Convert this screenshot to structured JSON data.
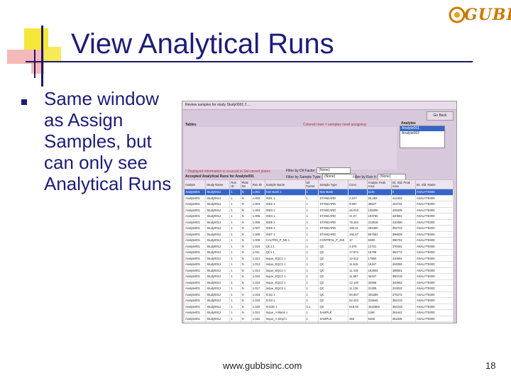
{
  "slide": {
    "title": "View Analytical Runs",
    "logo_text": "GUBBS",
    "bullet_text": "Same window as Assign Samples, but can only see Analytical Runs",
    "footer_url": "www.gubbsinc.com",
    "page_number": "18"
  },
  "screenshot": {
    "window_title": "Review samples for study Study0001 2 ...",
    "go_back_label": "Go Back",
    "tables_label": "Tables",
    "columns_note": "Colored rows = samples need assigning",
    "analytes_label": "Analytes",
    "analytes": [
      {
        "name": "Analyte001",
        "selected": true
      },
      {
        "name": "Analyte002",
        "selected": false
      }
    ],
    "filters": [
      {
        "label": "Filter by Dil Factor:",
        "value": "(None)"
      },
      {
        "label": "Filter by Sample Type:",
        "value": "(None)"
      },
      {
        "label": "Filter by Run #:",
        "value": "(None)"
      }
    ],
    "red_note": "* Displayed information is sourced in Sel-ctered plates",
    "accepted_label": "Accepted Analytical Runs for Analyte001",
    "grid": {
      "columns": [
        "Analyte",
        "Study Name",
        "Run ID",
        "Plate No",
        "Run ID",
        "Sample Name",
        "Dil Factor",
        "Sample Type",
        "Conc.",
        "Analyte Peak Area",
        "Int. Std. Peak Area",
        "Int. Std. Name"
      ],
      "rows": [
        [
          "Analyte001",
          "Study0012",
          "1",
          "N",
          "1.001",
          "Non-Bank 1",
          "1",
          "Non-Bank",
          "",
          "1146",
          "0",
          "ANALYTE000"
        ],
        [
          "Analyte001",
          "Study0012",
          "1",
          "N",
          "1.002",
          "ISD1 1",
          "1",
          "STANDARD",
          "4.047",
          "25,483",
          "412402",
          "ANALYTE000"
        ],
        [
          "Analyte001",
          "Study0012",
          "1",
          "N",
          "1.003",
          "ISD2 1",
          "1",
          "STANDARD",
          "9.067",
          "35627",
          "443731",
          "ANALYTE000"
        ],
        [
          "Analyte001",
          "Study0012",
          "1",
          "N",
          "1.004",
          "ISD3 1",
          "1",
          "STANDARD",
          "25.010",
          "135300",
          "429205",
          "ANALYTE000"
        ],
        [
          "Analyte001",
          "Study0012",
          "1",
          "N",
          "1.005",
          "ISD4 1",
          "1",
          "STANDARD",
          "41.07",
          "193765",
          "420561",
          "ANALYTE000"
        ],
        [
          "Analyte001",
          "Study0012",
          "1",
          "N",
          "1.006",
          "ISD5 1",
          "1",
          "STANDARD",
          "75.264",
          "313616",
          "410490",
          "ANALYTE000"
        ],
        [
          "Analyte001",
          "Study0012",
          "1",
          "N",
          "1.007",
          "ISD6 1",
          "1",
          "STANDARD",
          "182.01",
          "294450",
          "392702",
          "ANALYTE000"
        ],
        [
          "Analyte001",
          "Study0012",
          "1",
          "N",
          "1.008",
          "ISD7 1",
          "1",
          "STANDARD",
          "192.57",
          "567561",
          "398528",
          "ANALYTE000"
        ],
        [
          "Analyte001",
          "Study0012",
          "1",
          "N",
          "1.009",
          "CALTRO_P_NK 1",
          "1",
          "CONTROL_P_INK",
          "17",
          "6380",
          "396751",
          "ANALYTE000"
        ],
        [
          "Analyte001",
          "Study0012",
          "1",
          "N",
          "1.010",
          "QC1 1",
          "1",
          "QC",
          "4.675",
          "12731",
          "376491",
          "ANALYTE000"
        ],
        [
          "Analyte001",
          "Study0012",
          "1",
          "N",
          "1.011",
          "QC1 1",
          "1",
          "QC",
          "17.974",
          "16796",
          "350772",
          "ANALYTE000"
        ],
        [
          "Analyte001",
          "Study0012",
          "1",
          "N",
          "1.012",
          "Inque_EQC1 1",
          "1",
          "QC",
          "12.612",
          "17560",
          "410591",
          "ANALYTE000"
        ],
        [
          "Analyte001",
          "Study0012",
          "1",
          "N",
          "1.013",
          "Inque_EQC1 1",
          "1",
          "QC",
          "11.515",
          "15347",
          "404092",
          "ANALYTE000"
        ],
        [
          "Analyte001",
          "Study0012",
          "1",
          "N",
          "1.014",
          "Inque_EQC2 1",
          "1",
          "QC",
          "11.419",
          "152602",
          "389551",
          "ANALYTE000"
        ],
        [
          "Analyte001",
          "Study0012",
          "1",
          "N",
          "1.015",
          "Inque_EQC2 1",
          "1",
          "QC",
          "11.557",
          "34347",
          "350215",
          "ANALYTE000"
        ],
        [
          "Analyte001",
          "Study0012",
          "1",
          "N",
          "1.016",
          "Inque_EQC3 1",
          "1",
          "QC",
          "12.130",
          "32658",
          "340552",
          "ANALYTE000"
        ],
        [
          "Analyte001",
          "Study0012",
          "1",
          "N",
          "1.017",
          "Inque_EQC3 1",
          "1",
          "QC",
          "11.135",
          "31305",
          "313022",
          "ANALYTE000"
        ],
        [
          "Analyte001",
          "Study0012",
          "1",
          "N",
          "1.018",
          "ICS3 1",
          "1",
          "QC",
          "50.657",
          "345355",
          "375372",
          "ANALYTE000"
        ],
        [
          "Analyte001",
          "Study0012",
          "1",
          "N",
          "1.019",
          "ICS3 1",
          "1",
          "QC",
          "52.423",
          "315645",
          "364219",
          "ANALYTE000"
        ],
        [
          "Analyte001",
          "Study0012",
          "1",
          "N",
          "1.020",
          "ICS3D 1",
          "0.1",
          "QC",
          "618.49",
          "3422956",
          "382233",
          "ANALYTE000"
        ],
        [
          "Analyte001",
          "Study0012",
          "1",
          "N",
          "1.021",
          "Inque_A Blank 1",
          "1",
          "SAMPLE",
          "",
          "1186",
          "364441",
          "ANALYTE000"
        ],
        [
          "Analyte001",
          "Study0012",
          "1",
          "N",
          "1.022",
          "Inque_A Smpl 1",
          "1",
          "SAMPLE",
          "353",
          "5459",
          "361935",
          "ANALYTE000"
        ],
        [
          "Analyte001",
          "Study0012",
          "1",
          "N",
          "1.023",
          "Inque_A 1",
          "1",
          "SAMPLE",
          "15.19",
          "18530",
          "369250",
          "ANALYTE000"
        ],
        [
          "Analyte001",
          "Study0012",
          "1",
          "N",
          "1.024",
          "C1 2 1",
          "1",
          "QC",
          "11.615",
          "18480",
          "358193",
          "ANALYTE000"
        ]
      ]
    }
  }
}
